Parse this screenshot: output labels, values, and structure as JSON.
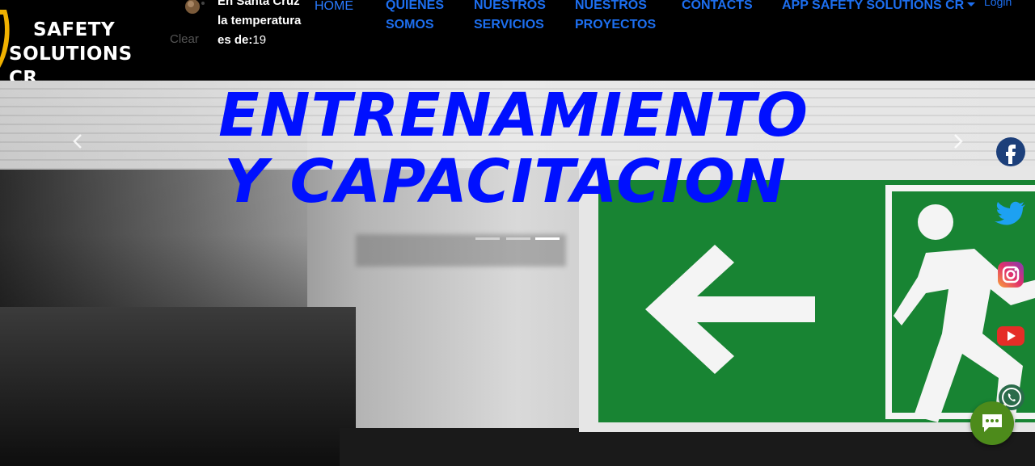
{
  "brand": {
    "line1": "SAFETY",
    "line2": "SOLUTIONS CR",
    "logo_icon": "shield-logo-icon"
  },
  "weather": {
    "condition": "Clear",
    "icon": "weather-clear-icon",
    "text": "En Santa Cruz la temperatura es de:",
    "temperature": "19"
  },
  "nav": {
    "home": "HOME",
    "quienes_1": "QUIENES",
    "quienes_2": "SOMOS",
    "servicios_1": "NUESTROS",
    "servicios_2": "SERVICIOS",
    "proyectos_1": "NUESTROS",
    "proyectos_2": "PROYECTOS",
    "contacts": "CONTACTS",
    "app": "APP SAFETY SOLUTIONS CR",
    "login": "Login"
  },
  "hero": {
    "title_line1": "ENTRENAMIENTO",
    "title_line2": "Y CAPACITACION",
    "indicators": 3,
    "active_indicator": 2
  },
  "social": {
    "facebook": "facebook-icon",
    "twitter": "twitter-icon",
    "instagram": "instagram-icon",
    "youtube": "youtube-icon",
    "whatsapp": "whatsapp-icon",
    "chat": "chat-bubble-icon"
  },
  "colors": {
    "nav_link": "#1d6ff0",
    "hero_title": "#0010ff",
    "exit_green": "#188433",
    "chat": "#4d8b1b"
  }
}
